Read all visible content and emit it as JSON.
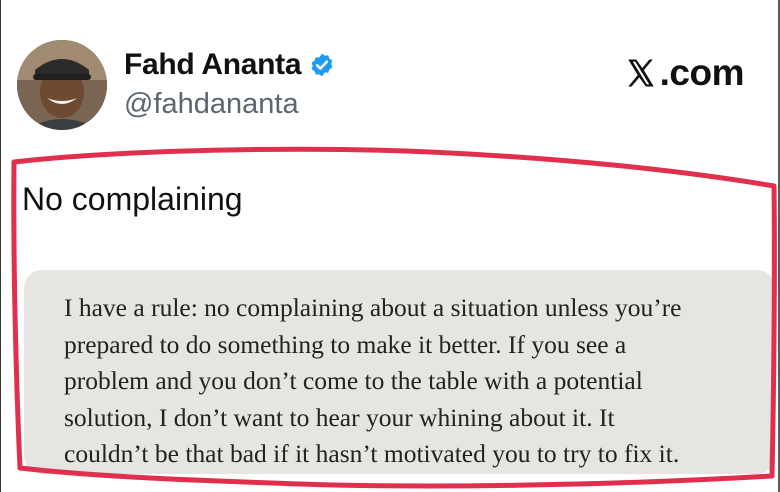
{
  "author": {
    "display_name": "Fahd Ananta",
    "handle": "@fahdananta",
    "verified_icon": "verified-badge-icon",
    "avatar_icon": "profile-photo"
  },
  "site": {
    "logo_text": ".com",
    "logo_icon": "x-logo-icon"
  },
  "post": {
    "text": "No complaining"
  },
  "quote_image": {
    "lines": [
      "I have a rule: no complaining about a situation unless you’re",
      "prepared to do something to make it better. If you see a",
      "problem and you don’t come to the table with a potential",
      "solution, I don’t want to hear your whining about it. It",
      "couldn’t be that bad if it hasn’t motivated you to try to fix it."
    ]
  },
  "colors": {
    "highlight_outline": "#e0304e",
    "verified_badge": "#1d9bf0",
    "handle_text": "#5b6670",
    "quote_background": "#e6e5e1"
  }
}
